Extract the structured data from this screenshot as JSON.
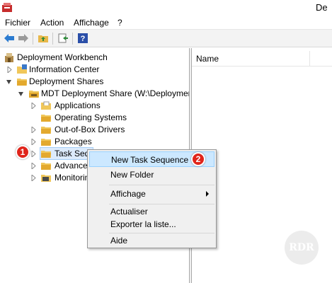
{
  "titlebar": {
    "title": "De"
  },
  "menubar": {
    "items": [
      {
        "label": "Fichier"
      },
      {
        "label": "Action"
      },
      {
        "label": "Affichage"
      },
      {
        "label": "?"
      }
    ]
  },
  "toolbar": {
    "buttons": [
      "back-arrow-icon",
      "forward-arrow-icon",
      "folder-up-icon",
      "export-icon",
      "help-icon"
    ]
  },
  "tree": {
    "root": {
      "label": "Deployment Workbench"
    },
    "information_center": {
      "label": "Information Center"
    },
    "deployment_shares": {
      "label": "Deployment Shares"
    },
    "mdt_share": {
      "label": "MDT Deployment Share (W:\\DeploymentS"
    },
    "applications": {
      "label": "Applications"
    },
    "operating_systems": {
      "label": "Operating Systems"
    },
    "drivers": {
      "label": "Out-of-Box Drivers"
    },
    "packages": {
      "label": "Packages"
    },
    "task_sequences": {
      "label": "Task Seque"
    },
    "advanced": {
      "label": "Advance"
    },
    "monitoring": {
      "label": "Monitorin"
    }
  },
  "list_pane": {
    "column_name": "Name"
  },
  "context_menu": {
    "items": [
      {
        "label": "New Task Sequence"
      },
      {
        "label": "New Folder"
      },
      {
        "label": "Affichage"
      },
      {
        "label": "Actualiser"
      },
      {
        "label": "Exporter la liste..."
      },
      {
        "label": "Aide"
      }
    ]
  },
  "badges": {
    "first": "1",
    "second": "2"
  },
  "watermark": {
    "text": "RDR"
  },
  "colors": {
    "selection_bg": "#dcebfc",
    "menu_highlight": "#cce8ff",
    "badge_red": "#e0251b",
    "folder_yellow": "#f0c75a"
  }
}
